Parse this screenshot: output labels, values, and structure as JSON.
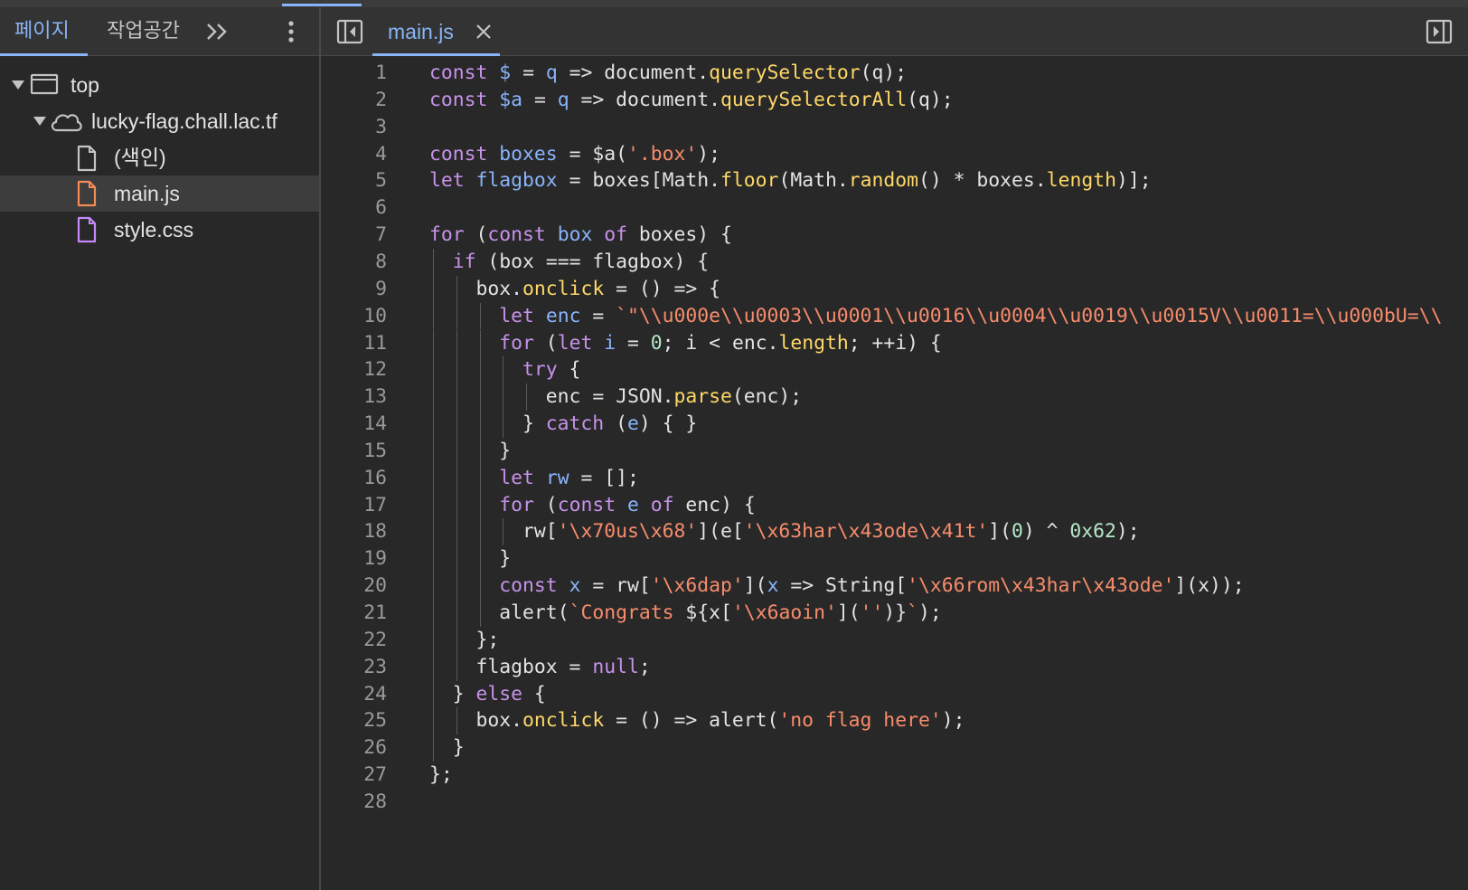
{
  "left_panel": {
    "tabs": [
      {
        "label": "페이지",
        "active": true
      },
      {
        "label": "작업공간",
        "active": false
      }
    ],
    "more_tabs_icon": "chevron-double-right-icon",
    "menu_icon": "kebab-menu-icon",
    "tree": [
      {
        "label": "top",
        "icon": "frame-icon",
        "expanded": true
      },
      {
        "label": "lucky-flag.chall.lac.tf",
        "icon": "cloud-icon",
        "expanded": true
      },
      {
        "label": "(색인)",
        "icon": "file-icon"
      },
      {
        "label": "main.js",
        "icon": "js-file-icon",
        "selected": true
      },
      {
        "label": "style.css",
        "icon": "css-file-icon"
      }
    ]
  },
  "editor": {
    "open_tab": {
      "label": "main.js"
    },
    "colors": {
      "accent": "#8ab4f8",
      "keyword": "#c792ea",
      "string": "#f78c6c",
      "function": "#ffd866",
      "variable": "#89b4fa"
    },
    "lines": [
      "const $ = q => document.querySelector(q);",
      "const $a = q => document.querySelectorAll(q);",
      "",
      "const boxes = $a('.box');",
      "let flagbox = boxes[Math.floor(Math.random() * boxes.length)];",
      "",
      "for (const box of boxes) {",
      "  if (box === flagbox) {",
      "    box.onclick = () => {",
      "      let enc = `\"\\\\u000e\\\\u0003\\\\u0001\\\\u0016\\\\u0004\\\\u0019\\\\u0015V\\\\u0011=\\\\u000bU=\\\\",
      "      for (let i = 0; i < enc.length; ++i) {",
      "        try {",
      "          enc = JSON.parse(enc);",
      "        } catch (e) { }",
      "      }",
      "      let rw = [];",
      "      for (const e of enc) {",
      "        rw['\\x70us\\x68'](e['\\x63har\\x43ode\\x41t'](0) ^ 0x62);",
      "      }",
      "      const x = rw['\\x6dap'](x => String['\\x66rom\\x43har\\x43ode'](x));",
      "      alert(`Congrats ${x['\\x6aoin']('')}`);",
      "    };",
      "    flagbox = null;",
      "  } else {",
      "    box.onclick = () => alert('no flag here');",
      "  }",
      "};",
      ""
    ]
  }
}
